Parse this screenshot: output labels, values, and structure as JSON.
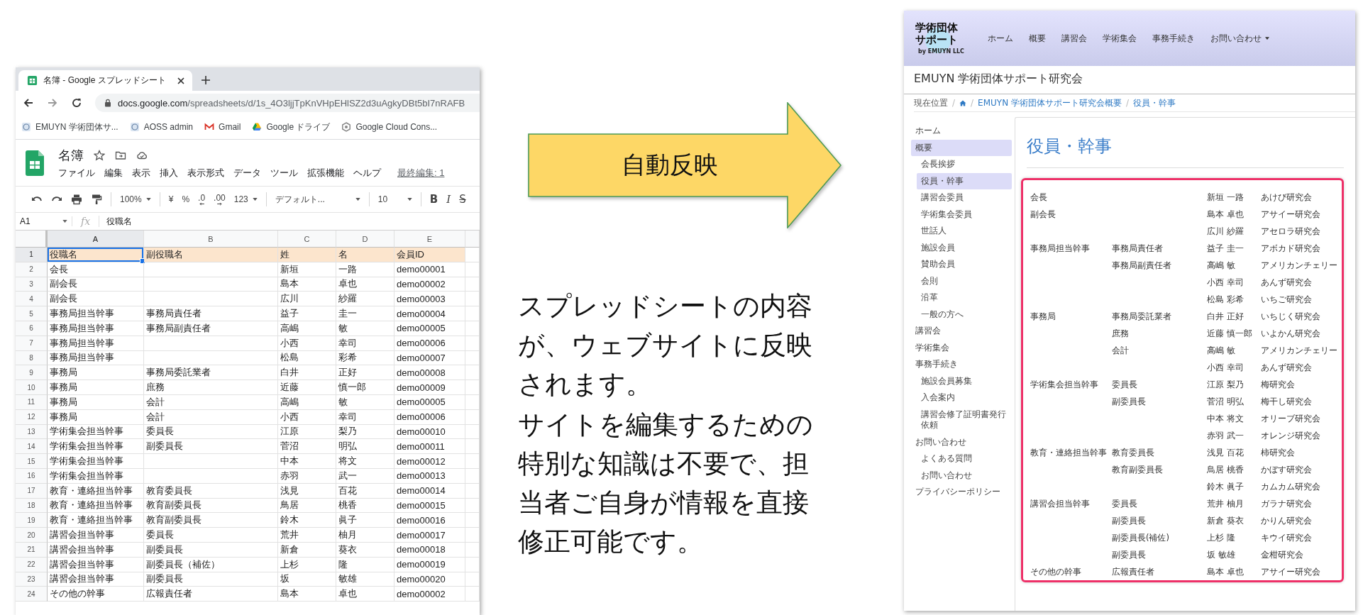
{
  "sheet": {
    "browser": {
      "tab_title": "名簿 - Google スプレッドシート",
      "url_host": "docs.google.com",
      "url_path": "/spreadsheets/d/1s_4O3ljjTpKnVHpEHlSZ2d3uAgkyDBt5bI7nRAFB",
      "bookmarks": [
        {
          "label": "EMUYN 学術団体サ...",
          "kind": "site"
        },
        {
          "label": "AOSS admin",
          "kind": "site"
        },
        {
          "label": "Gmail",
          "kind": "mail"
        },
        {
          "label": "Google ドライブ",
          "kind": "drive"
        },
        {
          "label": "Google Cloud Cons...",
          "kind": "cloud"
        }
      ]
    },
    "title": "名簿",
    "menus": [
      "ファイル",
      "編集",
      "表示",
      "挿入",
      "表示形式",
      "データ",
      "ツール",
      "拡張機能",
      "ヘルプ"
    ],
    "last_edit": "最終編集: 1",
    "toolbar": {
      "zoom": "100%",
      "format_buttons": [
        {
          "label": "¥",
          "kind": "plain"
        },
        {
          "label": "%",
          "kind": "plain"
        },
        {
          "label": ".0",
          "kind": "decimal_less"
        },
        {
          "label": ".00",
          "kind": "decimal_more"
        }
      ],
      "number_format": "123",
      "font": "デフォルト...",
      "font_size": "10",
      "style_buttons": [
        {
          "label": "B",
          "kind": "bold"
        },
        {
          "label": "I",
          "kind": "italic"
        },
        {
          "label": "S",
          "kind": "strike"
        }
      ]
    },
    "name_box": "A1",
    "fx": "fx",
    "formula": "役職名",
    "columns": [
      {
        "label": "A",
        "selected": true
      },
      {
        "label": "B",
        "selected": false
      },
      {
        "label": "C",
        "selected": false
      },
      {
        "label": "D",
        "selected": false
      },
      {
        "label": "E",
        "selected": false
      }
    ],
    "rows": [
      {
        "num": "1",
        "kind": "header",
        "selected": true,
        "cells": [
          "役職名",
          "副役職名",
          "姓",
          "名",
          "会員ID"
        ]
      },
      {
        "num": "2",
        "kind": "data",
        "selected": false,
        "cells": [
          "会長",
          {},
          "新垣",
          "一路",
          "demo00001"
        ]
      },
      {
        "num": "3",
        "kind": "data",
        "selected": false,
        "cells": [
          "副会長",
          {},
          "島本",
          "卓也",
          "demo00002"
        ]
      },
      {
        "num": "4",
        "kind": "data",
        "selected": false,
        "cells": [
          "副会長",
          {},
          "広川",
          "紗羅",
          "demo00003"
        ]
      },
      {
        "num": "5",
        "kind": "data",
        "selected": false,
        "cells": [
          "事務局担当幹事",
          "事務局責任者",
          "益子",
          "圭一",
          "demo00004"
        ]
      },
      {
        "num": "6",
        "kind": "data",
        "selected": false,
        "cells": [
          "事務局担当幹事",
          "事務局副責任者",
          "高嶋",
          "敏",
          "demo00005"
        ]
      },
      {
        "num": "7",
        "kind": "data",
        "selected": false,
        "cells": [
          "事務局担当幹事",
          {},
          "小西",
          "幸司",
          "demo00006"
        ]
      },
      {
        "num": "8",
        "kind": "data",
        "selected": false,
        "cells": [
          "事務局担当幹事",
          {},
          "松島",
          "彩希",
          "demo00007"
        ]
      },
      {
        "num": "9",
        "kind": "data",
        "selected": false,
        "cells": [
          "事務局",
          "事務局委託業者",
          "白井",
          "正好",
          "demo00008"
        ]
      },
      {
        "num": "10",
        "kind": "data",
        "selected": false,
        "cells": [
          "事務局",
          "庶務",
          "近藤",
          "慎一郎",
          "demo00009"
        ]
      },
      {
        "num": "11",
        "kind": "data",
        "selected": false,
        "cells": [
          "事務局",
          "会計",
          "高嶋",
          "敏",
          "demo00005"
        ]
      },
      {
        "num": "12",
        "kind": "data",
        "selected": false,
        "cells": [
          "事務局",
          "会計",
          "小西",
          "幸司",
          "demo00006"
        ]
      },
      {
        "num": "13",
        "kind": "data",
        "selected": false,
        "cells": [
          "学術集会担当幹事",
          "委員長",
          "江原",
          "梨乃",
          "demo00010"
        ]
      },
      {
        "num": "14",
        "kind": "data",
        "selected": false,
        "cells": [
          "学術集会担当幹事",
          "副委員長",
          "菅沼",
          "明弘",
          "demo00011"
        ]
      },
      {
        "num": "15",
        "kind": "data",
        "selected": false,
        "cells": [
          "学術集会担当幹事",
          {},
          "中本",
          "将文",
          "demo00012"
        ]
      },
      {
        "num": "16",
        "kind": "data",
        "selected": false,
        "cells": [
          "学術集会担当幹事",
          {},
          "赤羽",
          "武一",
          "demo00013"
        ]
      },
      {
        "num": "17",
        "kind": "data",
        "selected": false,
        "cells": [
          "教育・連絡担当幹事",
          "教育委員長",
          "浅見",
          "百花",
          "demo00014"
        ]
      },
      {
        "num": "18",
        "kind": "data",
        "selected": false,
        "cells": [
          "教育・連絡担当幹事",
          "教育副委員長",
          "鳥居",
          "桃香",
          "demo00015"
        ]
      },
      {
        "num": "19",
        "kind": "data",
        "selected": false,
        "cells": [
          "教育・連絡担当幹事",
          "教育副委員長",
          "鈴木",
          "眞子",
          "demo00016"
        ]
      },
      {
        "num": "20",
        "kind": "data",
        "selected": false,
        "cells": [
          "講習会担当幹事",
          "委員長",
          "荒井",
          "柚月",
          "demo00017"
        ]
      },
      {
        "num": "21",
        "kind": "data",
        "selected": false,
        "cells": [
          "講習会担当幹事",
          "副委員長",
          "新倉",
          "葵衣",
          "demo00018"
        ]
      },
      {
        "num": "22",
        "kind": "data",
        "selected": false,
        "cells": [
          "講習会担当幹事",
          "副委員長（補佐）",
          "上杉",
          "隆",
          "demo00019"
        ]
      },
      {
        "num": "23",
        "kind": "data",
        "selected": false,
        "cells": [
          "講習会担当幹事",
          "副委員長",
          "坂",
          "敏雄",
          "demo00020"
        ]
      },
      {
        "num": "24",
        "kind": "data",
        "selected": false,
        "cells": [
          "その他の幹事",
          "広報責任者",
          "島本",
          "卓也",
          "demo00002"
        ]
      }
    ]
  },
  "arrow_label": "自動反映",
  "paragraphs": [
    "スプレッドシートの内容が、ウェブサイトに反映されます。",
    "サイトを編集するための特別な知識は不要で、担当者ご自身が情報を直接修正可能です。"
  ],
  "site": {
    "logo": {
      "line1": "学術団体",
      "line2": "サポート",
      "byline": "by EMUYN LLC"
    },
    "nav": [
      {
        "label": "ホーム",
        "dropdown": false
      },
      {
        "label": "概要",
        "dropdown": false
      },
      {
        "label": "講習会",
        "dropdown": false
      },
      {
        "label": "学術集会",
        "dropdown": false
      },
      {
        "label": "事務手続き",
        "dropdown": false
      },
      {
        "label": "お問い合わせ",
        "dropdown": true
      }
    ],
    "title": "EMUYN 学術団体サポート研究会",
    "breadcrumb": [
      {
        "kind": "label",
        "text": "現在位置",
        "sep": "/"
      },
      {
        "kind": "home",
        "sep": "/"
      },
      {
        "kind": "link",
        "text": "EMUYN 学術団体サポート研究会概要",
        "sep": "/"
      },
      {
        "kind": "link",
        "text": "役員・幹事"
      }
    ],
    "sidebar": [
      {
        "label": "ホーム",
        "selected": false
      },
      {
        "label": "概要",
        "selected": true,
        "children": [
          {
            "label": "会長挨拶",
            "selected": false
          },
          {
            "label": "役員・幹事",
            "selected": true
          },
          {
            "label": "講習会委員",
            "selected": false
          },
          {
            "label": "学術集会委員",
            "selected": false
          },
          {
            "label": "世話人",
            "selected": false
          },
          {
            "label": "施設会員",
            "selected": false
          },
          {
            "label": "賛助会員",
            "selected": false
          },
          {
            "label": "会則",
            "selected": false
          },
          {
            "label": "沿革",
            "selected": false
          },
          {
            "label": "一般の方へ",
            "selected": false
          }
        ]
      },
      {
        "label": "講習会",
        "selected": false
      },
      {
        "label": "学術集会",
        "selected": false
      },
      {
        "label": "事務手続き",
        "selected": false,
        "children": [
          {
            "label": "施設会員募集",
            "selected": false
          },
          {
            "label": "入会案内",
            "selected": false
          },
          {
            "label": "講習会修了証明書発行依頼",
            "selected": false
          }
        ]
      },
      {
        "label": "お問い合わせ",
        "selected": false,
        "children": [
          {
            "label": "よくある質問",
            "selected": false
          },
          {
            "label": "お問い合わせ",
            "selected": false
          }
        ]
      },
      {
        "label": "プライバシーポリシー",
        "selected": false
      }
    ],
    "heading": "役員・幹事",
    "roster": [
      {
        "role": "会長",
        "name": "新垣 一路",
        "org": "あけび研究会"
      },
      {
        "role": "副会長",
        "name": "島本 卓也",
        "org": "アサイー研究会"
      },
      {
        "name": "広川 紗羅",
        "org": "アセロラ研究会"
      },
      {
        "role": "事務局担当幹事",
        "sub": "事務局責任者",
        "name": "益子 圭一",
        "org": "アボカド研究会"
      },
      {
        "sub": "事務局副責任者",
        "name": "高嶋 敏",
        "org": "アメリカンチェリー"
      },
      {
        "name": "小西 幸司",
        "org": "あんず研究会"
      },
      {
        "name": "松島 彩希",
        "org": "いちご研究会"
      },
      {
        "role": "事務局",
        "sub": "事務局委託業者",
        "name": "白井 正好",
        "org": "いちじく研究会"
      },
      {
        "sub": "庶務",
        "name": "近藤 慎一郎",
        "org": "いよかん研究会"
      },
      {
        "sub": "会計",
        "name": "高嶋 敏",
        "org": "アメリカンチェリー"
      },
      {
        "name": "小西 幸司",
        "org": "あんず研究会"
      },
      {
        "role": "学術集会担当幹事",
        "sub": "委員長",
        "name": "江原 梨乃",
        "org": "梅研究会"
      },
      {
        "sub": "副委員長",
        "name": "菅沼 明弘",
        "org": "梅干し研究会"
      },
      {
        "name": "中本 将文",
        "org": "オリーブ研究会"
      },
      {
        "name": "赤羽 武一",
        "org": "オレンジ研究会"
      },
      {
        "role": "教育・連絡担当幹事",
        "sub": "教育委員長",
        "name": "浅見 百花",
        "org": "柿研究会"
      },
      {
        "sub": "教育副委員長",
        "name": "鳥居 桃香",
        "org": "かぼす研究会"
      },
      {
        "name": "鈴木 眞子",
        "org": "カムカム研究会"
      },
      {
        "role": "講習会担当幹事",
        "sub": "委員長",
        "name": "荒井 柚月",
        "org": "ガラナ研究会"
      },
      {
        "sub": "副委員長",
        "name": "新倉 葵衣",
        "org": "かりん研究会"
      },
      {
        "sub": "副委員長(補佐)",
        "name": "上杉 隆",
        "org": "キウイ研究会"
      },
      {
        "sub": "副委員長",
        "name": "坂 敏雄",
        "org": "金柑研究会"
      },
      {
        "role": "その他の幹事",
        "sub": "広報責任者",
        "name": "島本 卓也",
        "org": "アサイー研究会"
      }
    ]
  }
}
